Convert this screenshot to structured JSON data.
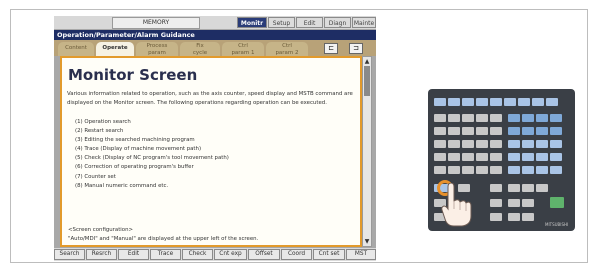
{
  "screen": {
    "memory_label": "MEMORY",
    "mode_tabs": [
      "Monitr",
      "Setup",
      "Edit",
      "Diagn",
      "Mainte"
    ],
    "active_mode": "Monitr",
    "guide_title": "Operation/Parameter/Alarm Guidance",
    "guide_tabs": [
      {
        "line1": "Content",
        "line2": ""
      },
      {
        "line1": "Operate",
        "line2": ""
      },
      {
        "line1": "Process",
        "line2": "param"
      },
      {
        "line1": "Fix",
        "line2": "cycle"
      },
      {
        "line1": "Ctrl",
        "line2": "param 1"
      },
      {
        "line1": "Ctrl",
        "line2": "param 2"
      }
    ],
    "active_guide_tab": "Operate",
    "nav_buttons": [
      "⊏",
      "⊐"
    ],
    "heading": "Monitor Screen",
    "paragraph": "Various information related to operation, such as the axis counter, speed display and MSTB command are displayed on the Monitor screen. The following operations regarding operation can be executed.",
    "items": [
      "(1) Operation search",
      "(2) Restart search",
      "(3) Editing the searched machining program",
      "(4) Trace (Display of machine movement path)",
      "(5) Check (Display of NC program's tool movement path)",
      "(6) Correction of operating program's buffer",
      "(7) Counter set",
      "(8) Manual numeric command    etc."
    ],
    "config_heading": "<Screen configuration>",
    "config_text": "\"Auto/MDI\" and \"Manual\" are displayed at the upper left of the screen.",
    "scroll_up": "▲",
    "scroll_down": "▼",
    "softkeys": [
      "Search",
      "Resrch",
      "Edit",
      "Trace",
      "Check",
      "Cnt exp",
      "Offset",
      "Coord",
      "Cnt set",
      "MST"
    ]
  },
  "keypad": {
    "brand": "MITSUBISHI",
    "highlight_key": "function-key"
  },
  "colors": {
    "content_border": "#e29a2c",
    "title_bar": "#1e2d64",
    "tabs_bar": "#b8a278"
  }
}
